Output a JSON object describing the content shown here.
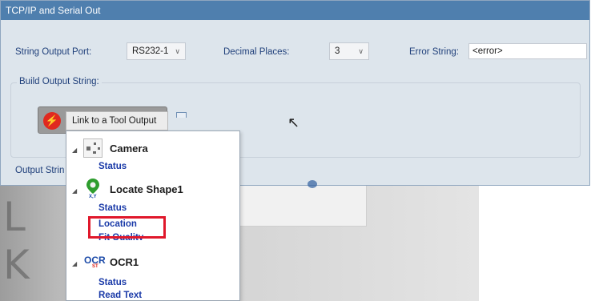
{
  "panel": {
    "title": "TCP/IP and Serial Out"
  },
  "settings": {
    "port_label": "String Output Port:",
    "port_value": "RS232-1",
    "decimal_label": "Decimal Places:",
    "decimal_value": "3",
    "error_label": "Error String:",
    "error_value": "<error>"
  },
  "build": {
    "legend": "Build Output String:",
    "link_label": "Link to a Tool Output"
  },
  "output_label": "Output Strin",
  "tree": [
    {
      "title": "Camera",
      "icon": "camera-icon",
      "items": [
        "Status"
      ]
    },
    {
      "title": "Locate Shape1",
      "icon": "locate-pin-icon",
      "items": [
        "Status",
        "Location",
        "Fit Quality"
      ]
    },
    {
      "title": "OCR1",
      "icon": "ocr-icon",
      "items": [
        "Status",
        "Read Text"
      ]
    }
  ],
  "highlight_item": "Location",
  "colors": {
    "title_bar": "#4f7fae",
    "panel_bg": "#dde5ec",
    "link_blue": "#1a3aa8",
    "highlight_red": "#e0182b",
    "plug_red": "#e0291f"
  }
}
